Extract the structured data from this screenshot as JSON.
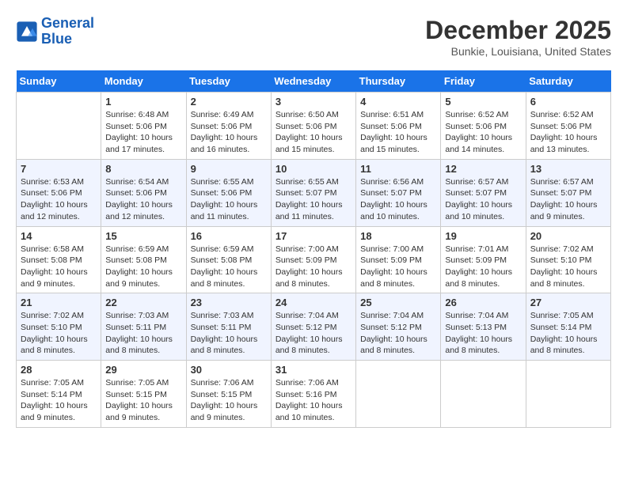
{
  "logo": {
    "line1": "General",
    "line2": "Blue"
  },
  "title": "December 2025",
  "location": "Bunkie, Louisiana, United States",
  "weekdays": [
    "Sunday",
    "Monday",
    "Tuesday",
    "Wednesday",
    "Thursday",
    "Friday",
    "Saturday"
  ],
  "weeks": [
    [
      {
        "day": null
      },
      {
        "day": "1",
        "sunrise": "6:48 AM",
        "sunset": "5:06 PM",
        "daylight": "10 hours and 17 minutes."
      },
      {
        "day": "2",
        "sunrise": "6:49 AM",
        "sunset": "5:06 PM",
        "daylight": "10 hours and 16 minutes."
      },
      {
        "day": "3",
        "sunrise": "6:50 AM",
        "sunset": "5:06 PM",
        "daylight": "10 hours and 15 minutes."
      },
      {
        "day": "4",
        "sunrise": "6:51 AM",
        "sunset": "5:06 PM",
        "daylight": "10 hours and 15 minutes."
      },
      {
        "day": "5",
        "sunrise": "6:52 AM",
        "sunset": "5:06 PM",
        "daylight": "10 hours and 14 minutes."
      },
      {
        "day": "6",
        "sunrise": "6:52 AM",
        "sunset": "5:06 PM",
        "daylight": "10 hours and 13 minutes."
      }
    ],
    [
      {
        "day": "7",
        "sunrise": "6:53 AM",
        "sunset": "5:06 PM",
        "daylight": "10 hours and 12 minutes."
      },
      {
        "day": "8",
        "sunrise": "6:54 AM",
        "sunset": "5:06 PM",
        "daylight": "10 hours and 12 minutes."
      },
      {
        "day": "9",
        "sunrise": "6:55 AM",
        "sunset": "5:06 PM",
        "daylight": "10 hours and 11 minutes."
      },
      {
        "day": "10",
        "sunrise": "6:55 AM",
        "sunset": "5:07 PM",
        "daylight": "10 hours and 11 minutes."
      },
      {
        "day": "11",
        "sunrise": "6:56 AM",
        "sunset": "5:07 PM",
        "daylight": "10 hours and 10 minutes."
      },
      {
        "day": "12",
        "sunrise": "6:57 AM",
        "sunset": "5:07 PM",
        "daylight": "10 hours and 10 minutes."
      },
      {
        "day": "13",
        "sunrise": "6:57 AM",
        "sunset": "5:07 PM",
        "daylight": "10 hours and 9 minutes."
      }
    ],
    [
      {
        "day": "14",
        "sunrise": "6:58 AM",
        "sunset": "5:08 PM",
        "daylight": "10 hours and 9 minutes."
      },
      {
        "day": "15",
        "sunrise": "6:59 AM",
        "sunset": "5:08 PM",
        "daylight": "10 hours and 9 minutes."
      },
      {
        "day": "16",
        "sunrise": "6:59 AM",
        "sunset": "5:08 PM",
        "daylight": "10 hours and 8 minutes."
      },
      {
        "day": "17",
        "sunrise": "7:00 AM",
        "sunset": "5:09 PM",
        "daylight": "10 hours and 8 minutes."
      },
      {
        "day": "18",
        "sunrise": "7:00 AM",
        "sunset": "5:09 PM",
        "daylight": "10 hours and 8 minutes."
      },
      {
        "day": "19",
        "sunrise": "7:01 AM",
        "sunset": "5:09 PM",
        "daylight": "10 hours and 8 minutes."
      },
      {
        "day": "20",
        "sunrise": "7:02 AM",
        "sunset": "5:10 PM",
        "daylight": "10 hours and 8 minutes."
      }
    ],
    [
      {
        "day": "21",
        "sunrise": "7:02 AM",
        "sunset": "5:10 PM",
        "daylight": "10 hours and 8 minutes."
      },
      {
        "day": "22",
        "sunrise": "7:03 AM",
        "sunset": "5:11 PM",
        "daylight": "10 hours and 8 minutes."
      },
      {
        "day": "23",
        "sunrise": "7:03 AM",
        "sunset": "5:11 PM",
        "daylight": "10 hours and 8 minutes."
      },
      {
        "day": "24",
        "sunrise": "7:04 AM",
        "sunset": "5:12 PM",
        "daylight": "10 hours and 8 minutes."
      },
      {
        "day": "25",
        "sunrise": "7:04 AM",
        "sunset": "5:12 PM",
        "daylight": "10 hours and 8 minutes."
      },
      {
        "day": "26",
        "sunrise": "7:04 AM",
        "sunset": "5:13 PM",
        "daylight": "10 hours and 8 minutes."
      },
      {
        "day": "27",
        "sunrise": "7:05 AM",
        "sunset": "5:14 PM",
        "daylight": "10 hours and 8 minutes."
      }
    ],
    [
      {
        "day": "28",
        "sunrise": "7:05 AM",
        "sunset": "5:14 PM",
        "daylight": "10 hours and 9 minutes."
      },
      {
        "day": "29",
        "sunrise": "7:05 AM",
        "sunset": "5:15 PM",
        "daylight": "10 hours and 9 minutes."
      },
      {
        "day": "30",
        "sunrise": "7:06 AM",
        "sunset": "5:15 PM",
        "daylight": "10 hours and 9 minutes."
      },
      {
        "day": "31",
        "sunrise": "7:06 AM",
        "sunset": "5:16 PM",
        "daylight": "10 hours and 10 minutes."
      },
      {
        "day": null
      },
      {
        "day": null
      },
      {
        "day": null
      }
    ]
  ]
}
